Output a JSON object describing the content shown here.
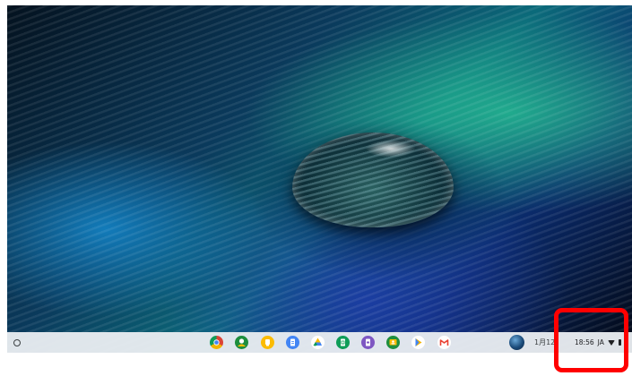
{
  "shelf": {
    "apps": [
      {
        "name": "chrome-icon",
        "color": "#db4437"
      },
      {
        "name": "android-messages-icon",
        "color": "#1e8e3e"
      },
      {
        "name": "google-keep-icon",
        "color": "#fbbc04"
      },
      {
        "name": "google-docs-icon",
        "color": "#4285f4"
      },
      {
        "name": "google-drive-icon",
        "color": "#0f9d58"
      },
      {
        "name": "google-sheets-icon",
        "color": "#0f9d58"
      },
      {
        "name": "google-slides-icon",
        "color": "#7e57c2"
      },
      {
        "name": "google-classroom-icon",
        "color": "#1e8e3e"
      },
      {
        "name": "google-play-icon",
        "color": "#f4b400"
      },
      {
        "name": "gmail-icon",
        "color": "#ea4335"
      }
    ],
    "date": "1月12",
    "time": "18:56",
    "ime": "JA"
  },
  "highlight_color": "#ff0000"
}
